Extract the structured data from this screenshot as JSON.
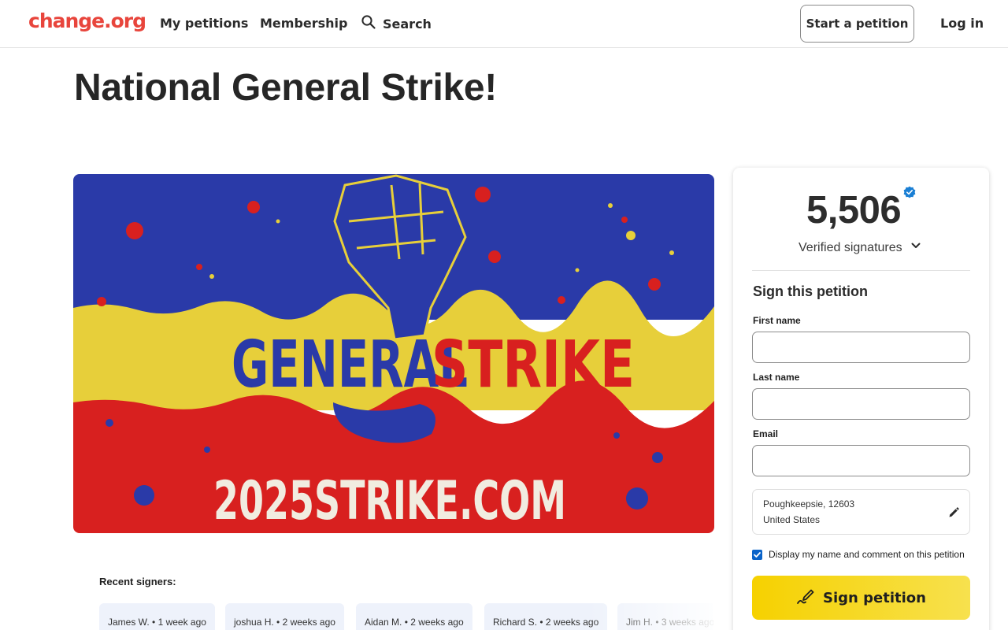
{
  "header": {
    "logo": "change.org",
    "nav": {
      "my_petitions": "My petitions",
      "membership": "Membership",
      "search": "Search"
    },
    "start_petition": "Start a petition",
    "login": "Log in"
  },
  "petition": {
    "title": "National General Strike!",
    "image": {
      "headline_left": "GENERAL",
      "headline_right": "STRIKE",
      "website": "2025STRIKE.COM",
      "colors": {
        "blue": "#2a3aa8",
        "yellow": "#e7cf3a",
        "red": "#d8201f"
      }
    }
  },
  "recent_signers": {
    "label": "Recent signers:",
    "items": [
      {
        "name": "James W.",
        "time": "1 week ago"
      },
      {
        "name": "joshua H.",
        "time": "2 weeks ago"
      },
      {
        "name": "Aidan M.",
        "time": "2 weeks ago"
      },
      {
        "name": "Richard S.",
        "time": "2 weeks ago"
      },
      {
        "name": "Jim H.",
        "time": "3 weeks ago"
      }
    ]
  },
  "sign_card": {
    "count": "5,506",
    "verified_label": "Verified signatures",
    "heading": "Sign this petition",
    "fields": {
      "first_name": "First name",
      "last_name": "Last name",
      "email": "Email"
    },
    "location": {
      "line1": "Poughkeepsie, 12603",
      "line2": "United States"
    },
    "consent": "Display my name and comment on this petition",
    "consent_checked": true,
    "sign_button": "Sign petition"
  },
  "colors": {
    "brand": "#e8453c",
    "sign_button": "#f6d100",
    "checkbox": "#0a63c9",
    "verified_badge": "#1a7fd4"
  }
}
